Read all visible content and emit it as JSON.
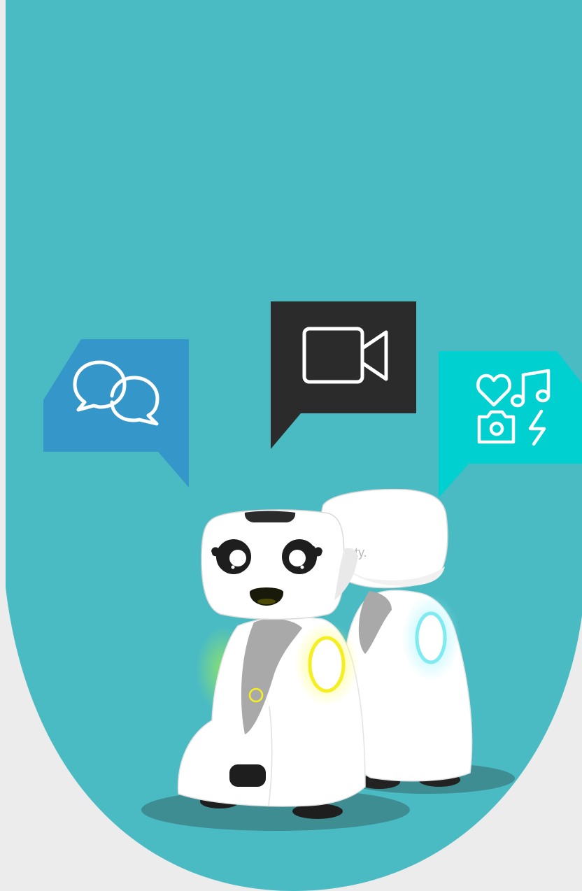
{
  "colors": {
    "page_background": "#ececec",
    "panel_teal": "#4bbbc3",
    "chat_bubble_blue": "#3596ca",
    "video_bubble_dark": "#2b2b2b",
    "media_bubble_cyan": "#00d0d0",
    "robot_white": "#ffffff",
    "robot_grey": "#a9a9a9",
    "shadow": "#3d8d92",
    "glow_yellow": "#f5ef22",
    "glow_green": "#8fe36a",
    "glow_cyan": "#7feaf2"
  },
  "icons": [
    "chat-bubbles-icon",
    "video-camera-icon",
    "media-icons-heart-music-camera-flash"
  ],
  "robots": {
    "front_robot": {
      "chest_light": "yellow",
      "side_glow": "green"
    },
    "back_robot": {
      "chest_light": "cyan",
      "brand_mark": "ty."
    }
  }
}
